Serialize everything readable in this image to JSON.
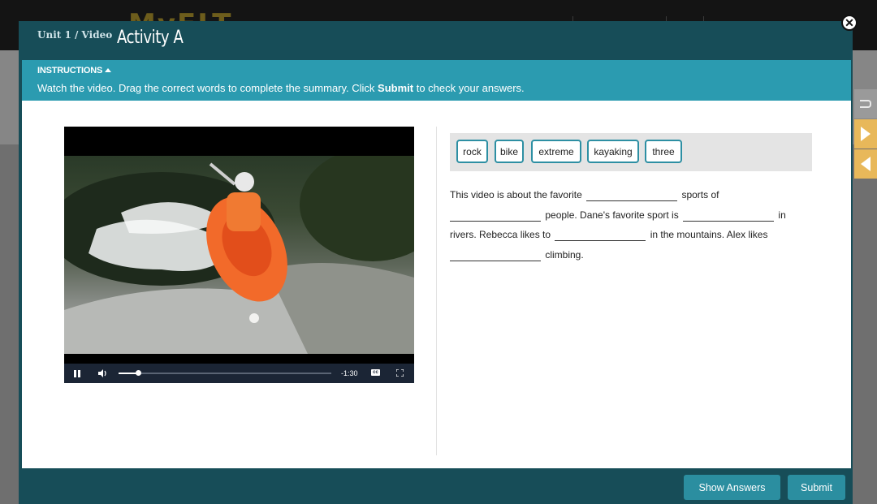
{
  "background": {
    "logo": "MyELT"
  },
  "modal": {
    "breadcrumb": "Unit 1 / Video",
    "title": "Activity A",
    "close_icon": "close-circle-icon"
  },
  "instructions": {
    "label": "INSTRUCTIONS",
    "text_before": "Watch the video. Drag the correct words to complete the summary. Click ",
    "text_bold": "Submit",
    "text_after": " to check your answers."
  },
  "video": {
    "time_remaining": "-1:30",
    "cc_label": "cc",
    "progress_percent": 9,
    "icons": [
      "pause-icon",
      "volume-icon",
      "closed-captions-icon",
      "fullscreen-icon"
    ]
  },
  "word_bank": [
    "rock",
    "bike",
    "extreme",
    "kayaking",
    "three"
  ],
  "summary": {
    "seg1": "This video is about the favorite",
    "seg2": "sports of",
    "seg3": "people. Dane's favorite sport is",
    "seg4": "in",
    "seg5": "rivers. Rebecca likes to",
    "seg6": "in the mountains. Alex likes",
    "seg7": "climbing."
  },
  "footer": {
    "show_answers": "Show Answers",
    "submit": "Submit"
  },
  "colors": {
    "modal_dark": "#174d58",
    "instructions_bar": "#2b9bb0",
    "button": "#2b8ea0",
    "chip_border": "#2d8fa3",
    "side_tab_orange": "#e8b85a"
  }
}
